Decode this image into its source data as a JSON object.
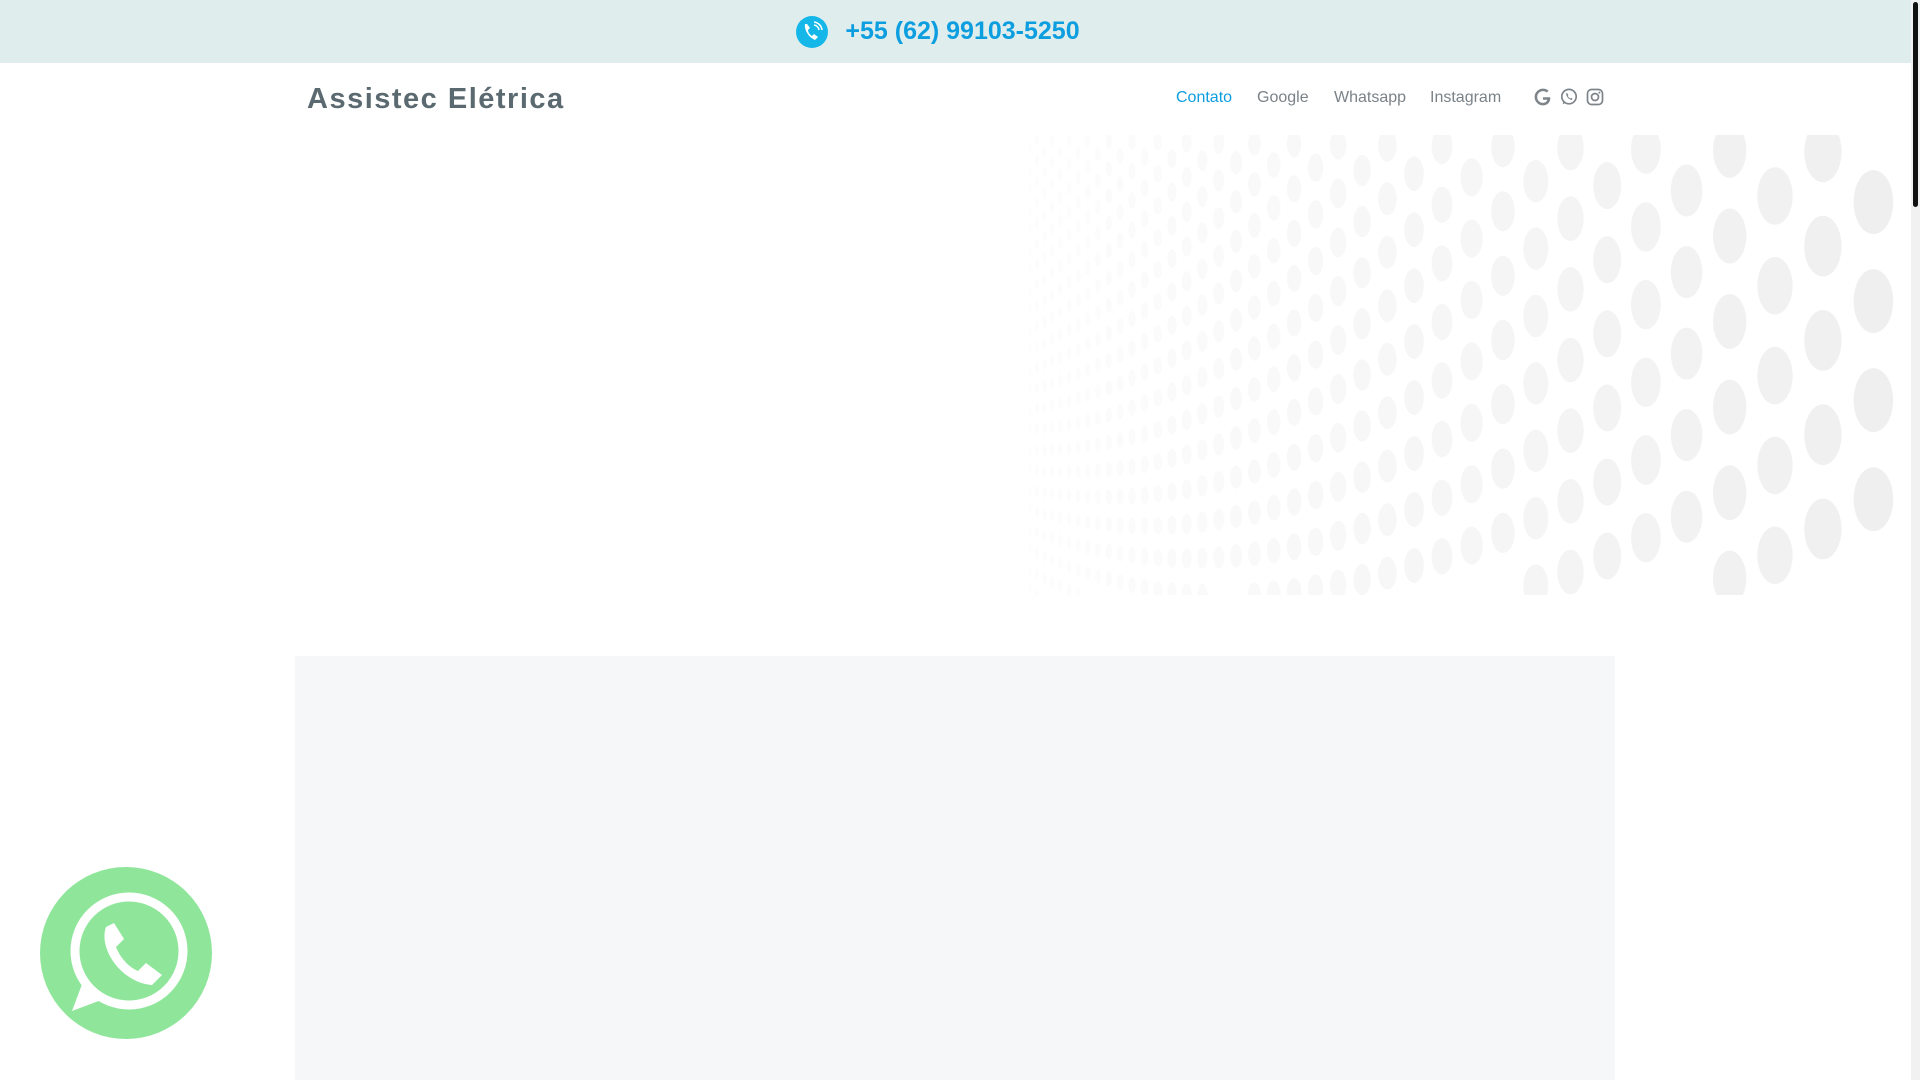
{
  "topbar": {
    "phone": "+55 (62) 99103-5250",
    "phone_icon": "phone-icon",
    "background": "#e0eded",
    "accent": "#0d9ee0"
  },
  "header": {
    "brand": "Assistec Elétrica",
    "nav": [
      {
        "label": "Contato",
        "active": true
      },
      {
        "label": "Google",
        "active": false
      },
      {
        "label": "Whatsapp",
        "active": false
      },
      {
        "label": "Instagram",
        "active": false
      }
    ],
    "social_icons": [
      "google-icon",
      "whatsapp-icon",
      "instagram-icon"
    ]
  },
  "floating_button": {
    "icon": "whatsapp-icon",
    "color": "#8fe69a"
  }
}
